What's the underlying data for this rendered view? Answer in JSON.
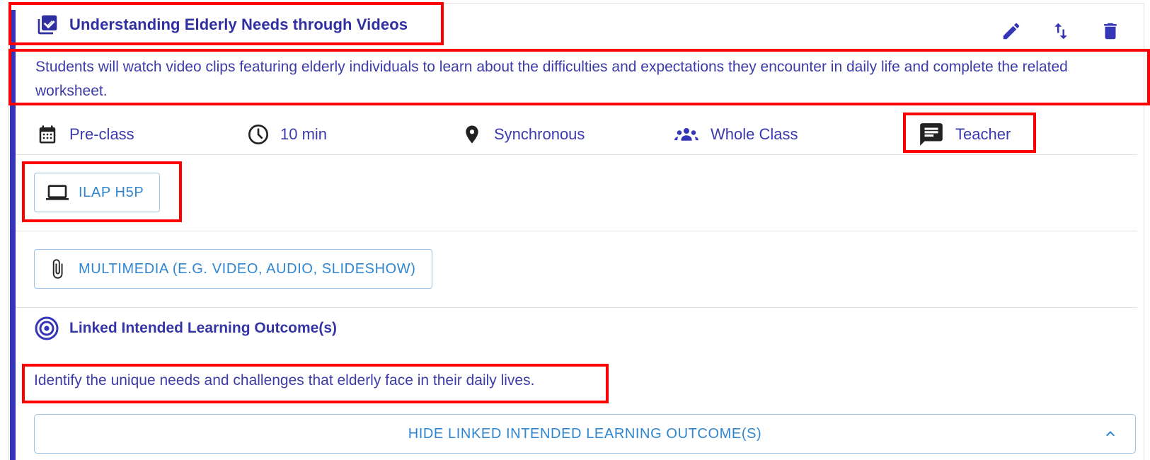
{
  "activity": {
    "title": "Understanding Elderly Needs through Videos",
    "description": "Students will watch video clips featuring elderly individuals to learn about the difficulties and expectations they encounter in daily life and complete the related worksheet.",
    "actions": {
      "edit_icon": "pencil-icon",
      "reorder_icon": "swap-vertical-icon",
      "delete_icon": "trash-icon"
    }
  },
  "meta": {
    "timing": {
      "icon": "calendar-icon",
      "label": "Pre-class"
    },
    "duration": {
      "icon": "clock-icon",
      "label": "10 min"
    },
    "mode": {
      "icon": "location-pin-icon",
      "label": "Synchronous"
    },
    "grouping": {
      "icon": "group-icon",
      "label": "Whole Class"
    },
    "lead": {
      "icon": "chat-bubble-icon",
      "label": "Teacher"
    }
  },
  "resources": [
    {
      "icon": "laptop-icon",
      "label": "ILAP H5P"
    },
    {
      "icon": "paperclip-icon",
      "label": "MULTIMEDIA (E.G. VIDEO, AUDIO, SLIDESHOW)"
    }
  ],
  "ilo": {
    "heading": "Linked Intended Learning Outcome(s)",
    "items": [
      "Identify the unique needs and challenges that elderly face in their daily lives."
    ],
    "toggle_label": "HIDE LINKED INTENDED LEARNING OUTCOME(S)"
  },
  "colors": {
    "accent": "#3535b8",
    "text": "#3c3ca8",
    "link": "#2f86d0",
    "highlight": "#ff0000"
  }
}
